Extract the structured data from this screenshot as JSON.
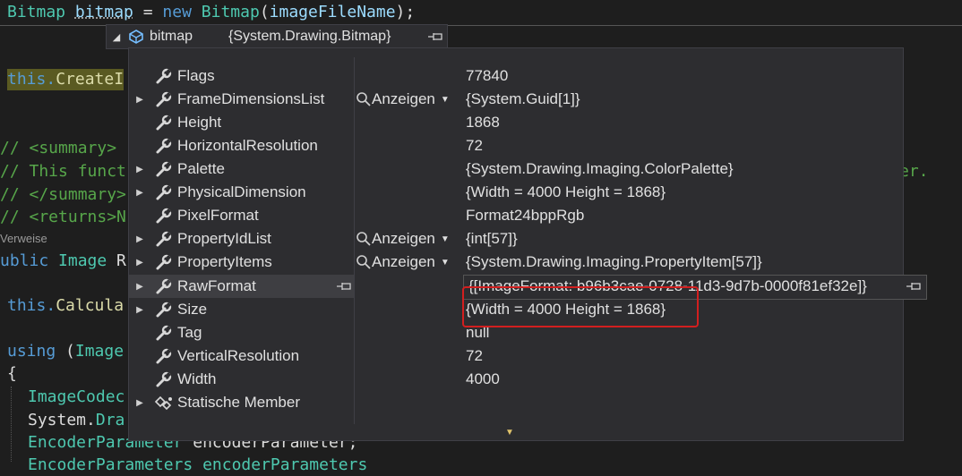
{
  "code": {
    "line1": {
      "t1": "Bitmap",
      "t2": "bitmap",
      "t3": " = ",
      "t4": "new",
      "t5": " ",
      "t6": "Bitmap",
      "t7": "(",
      "t8": "imageFileName",
      "t9": ");"
    },
    "line2": {
      "t1": "this.",
      "t2": "CreateI"
    },
    "line3": "// <summary>",
    "line4": "// This funct",
    "line4_tail": "er.",
    "line5": "// </summary>",
    "line6": "// <returns>N",
    "codelens": "Verweise",
    "line7": {
      "t1": "ublic",
      "t2": " ",
      "t3": "Image",
      "t4": " R"
    },
    "line8": {
      "t1": "this.",
      "t2": "Calcula"
    },
    "line9": {
      "t1": "using",
      "t2": " (",
      "t3": "Image"
    },
    "line10": "{",
    "line11": "ImageCodec",
    "line12": {
      "t1": "System.",
      "t2": "Dra"
    },
    "line13": {
      "t1": "EncoderParameter",
      "t2": " encoderParameter;"
    },
    "line14": "EncoderParameters encoderParameters"
  },
  "datatip": {
    "header": {
      "name": "bitmap",
      "value": "{System.Drawing.Bitmap}"
    },
    "rows": [
      {
        "name": "Flags",
        "view": "",
        "value": "77840"
      },
      {
        "name": "FrameDimensionsList",
        "view": "Anzeigen",
        "value": "{System.Guid[1]}"
      },
      {
        "name": "Height",
        "view": "",
        "value": "1868"
      },
      {
        "name": "HorizontalResolution",
        "view": "",
        "value": "72"
      },
      {
        "name": "Palette",
        "view": "",
        "value": "{System.Drawing.Imaging.ColorPalette}"
      },
      {
        "name": "PhysicalDimension",
        "view": "",
        "value": "{Width = 4000 Height = 1868}"
      },
      {
        "name": "PixelFormat",
        "view": "",
        "value": "Format24bppRgb"
      },
      {
        "name": "PropertyIdList",
        "view": "Anzeigen",
        "value": "{int[57]}"
      },
      {
        "name": "PropertyItems",
        "view": "Anzeigen",
        "value": "{System.Drawing.Imaging.PropertyItem[57]}"
      },
      {
        "name": "RawFormat",
        "view": "",
        "value": "{[ImageFormat: b96b3cae-0728-11d3-9d7b-0000f81ef32e]}"
      },
      {
        "name": "Size",
        "view": "",
        "value": "{Width = 4000 Height = 1868}"
      },
      {
        "name": "Tag",
        "view": "",
        "value": "null"
      },
      {
        "name": "VerticalResolution",
        "view": "",
        "value": "72"
      },
      {
        "name": "Width",
        "view": "",
        "value": "4000"
      },
      {
        "name": "Statische Member",
        "view": "",
        "value": ""
      }
    ]
  },
  "colors": {
    "highlight_box": "#d21f1f",
    "panel_bg": "#2d2d30",
    "editor_bg": "#1e1e1e"
  }
}
